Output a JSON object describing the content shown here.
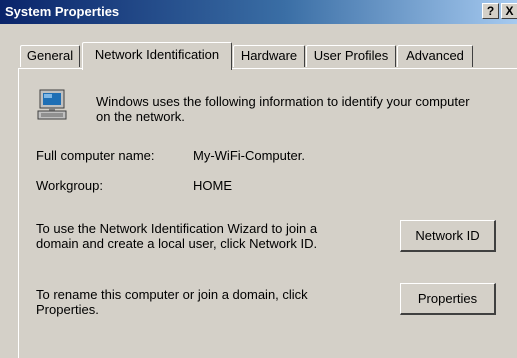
{
  "window": {
    "title": "System Properties",
    "help_label": "?",
    "close_label": "X"
  },
  "tabs": [
    {
      "label": "General"
    },
    {
      "label": "Network Identification"
    },
    {
      "label": "Hardware"
    },
    {
      "label": "User Profiles"
    },
    {
      "label": "Advanced"
    }
  ],
  "active_tab": "Network Identification",
  "panel": {
    "intro_line1": "Windows uses the following information to identify your computer",
    "intro_line2": "on the network.",
    "full_name_label": "Full computer name:",
    "full_name_value": "My-WiFi-Computer.",
    "workgroup_label": "Workgroup:",
    "workgroup_value": "HOME",
    "wizard_line1": "To use the Network Identification Wizard to join a",
    "wizard_line2": "domain and create a local user, click Network ID.",
    "network_id_button": "Network ID",
    "rename_line1": "To rename this computer or join a domain, click",
    "rename_line2": "Properties.",
    "properties_button": "Properties"
  },
  "icons": {
    "computer": "computer-icon"
  }
}
